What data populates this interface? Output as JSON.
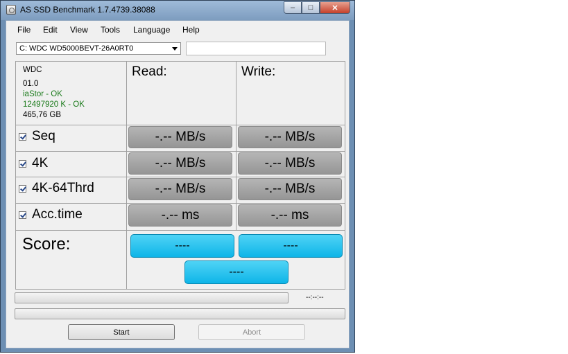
{
  "window": {
    "title": "AS SSD Benchmark 1.7.4739.38088"
  },
  "menu": [
    "File",
    "Edit",
    "View",
    "Tools",
    "Language",
    "Help"
  ],
  "drive_select": {
    "value": "C: WDC WD5000BEVT-26A0RT0"
  },
  "drive_info": {
    "model": "WDC",
    "firmware": "01.0",
    "driver": "iaStor - OK",
    "alignment": "12497920 K - OK",
    "size": "465,76 GB",
    "status_color": "#1a7a1a"
  },
  "headers": {
    "read": "Read:",
    "write": "Write:"
  },
  "tests": [
    {
      "label": "Seq",
      "checked": true,
      "read": "-.-- MB/s",
      "write": "-.-- MB/s"
    },
    {
      "label": "4K",
      "checked": true,
      "read": "-.-- MB/s",
      "write": "-.-- MB/s"
    },
    {
      "label": "4K-64Thrd",
      "checked": true,
      "read": "-.-- MB/s",
      "write": "-.-- MB/s"
    },
    {
      "label": "Acc.time",
      "checked": true,
      "read": "-.-- ms",
      "write": "-.-- ms"
    }
  ],
  "score": {
    "label": "Score:",
    "read": "----",
    "write": "----",
    "total": "----"
  },
  "progress": {
    "time": "--:--:--",
    "value": 0
  },
  "buttons": {
    "start": "Start",
    "abort": "Abort"
  },
  "colors": {
    "score_button": "#21c1ee",
    "result_button": "#a5a5a5"
  }
}
